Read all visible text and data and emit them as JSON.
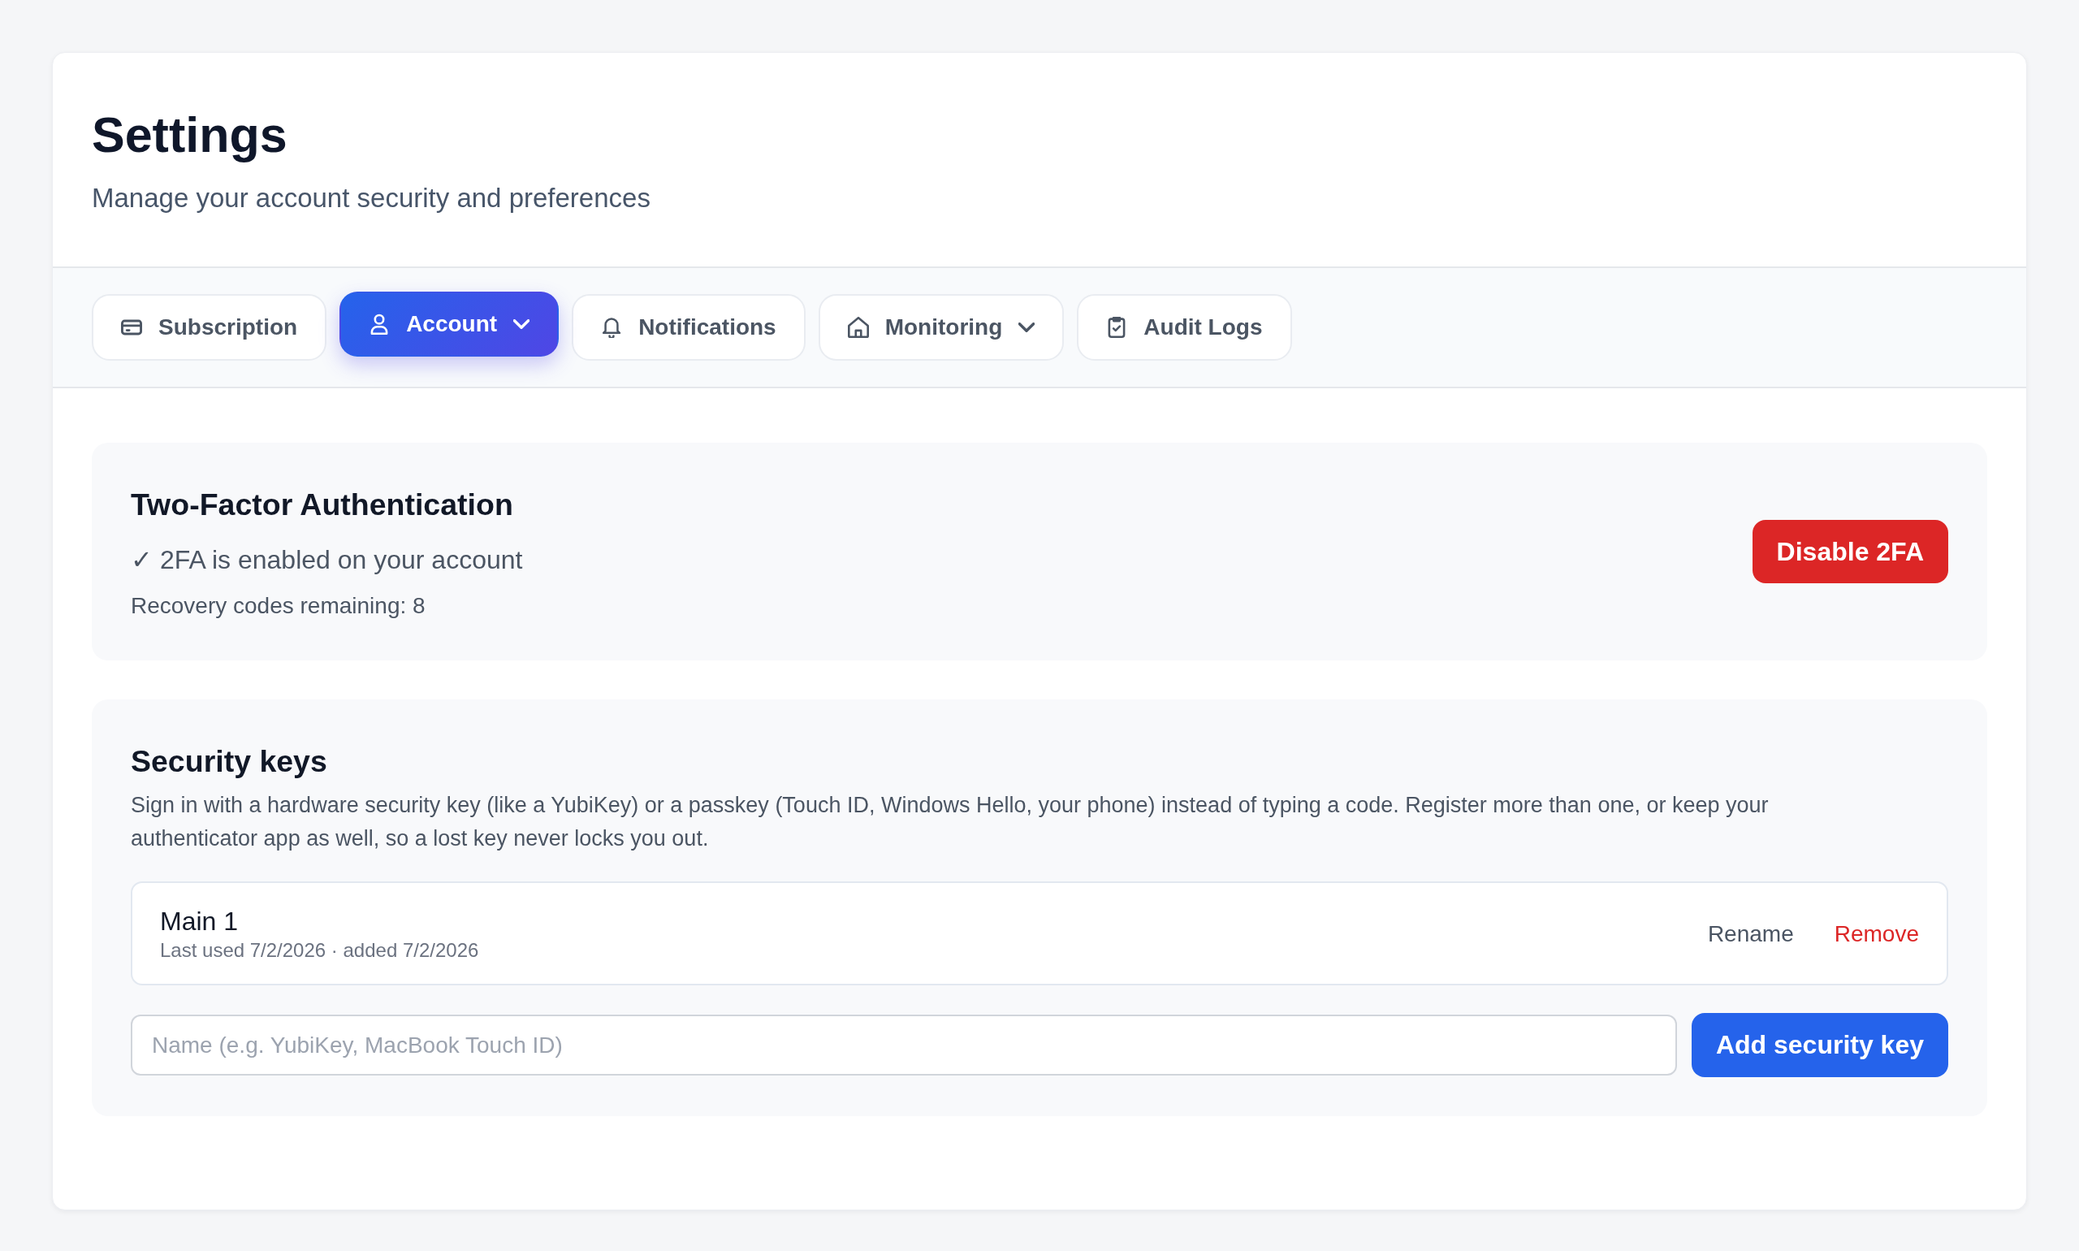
{
  "header": {
    "title": "Settings",
    "subtitle": "Manage your account security and preferences"
  },
  "tabs": [
    {
      "label": "Subscription",
      "selected": false,
      "dropdown": false
    },
    {
      "label": "Account",
      "selected": true,
      "dropdown": true
    },
    {
      "label": "Notifications",
      "selected": false,
      "dropdown": false
    },
    {
      "label": "Monitoring",
      "selected": false,
      "dropdown": true
    },
    {
      "label": "Audit Logs",
      "selected": false,
      "dropdown": false
    }
  ],
  "two_factor": {
    "title": "Two-Factor Authentication",
    "status": "✓ 2FA is enabled on your account",
    "recovery": "Recovery codes remaining: 8",
    "button": "Disable 2FA"
  },
  "security_keys": {
    "title": "Security keys",
    "description": "Sign in with a hardware security key (like a YubiKey) or a passkey (Touch ID, Windows Hello, your phone) instead of typing a code. Register more than one, or keep your authenticator app as well, so a lost key never locks you out.",
    "keys": [
      {
        "name": "Main 1",
        "meta": "Last used 7/2/2026 · added 7/2/2026",
        "actions": [
          {
            "label": "Rename",
            "kind": "neutral"
          },
          {
            "label": "Remove",
            "kind": "danger"
          }
        ]
      }
    ],
    "name_input": {
      "placeholder": "Name (e.g. YubiKey, MacBook Touch ID)"
    },
    "add_button": "Add security key"
  }
}
